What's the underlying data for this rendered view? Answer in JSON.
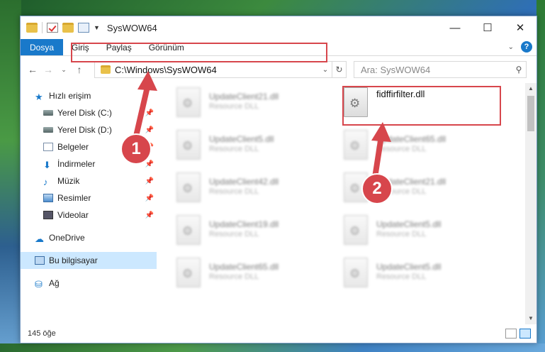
{
  "window": {
    "title": "SysWOW64",
    "controls": {
      "minimize": "—",
      "maximize": "☐",
      "close": "✕"
    }
  },
  "ribbon": {
    "tabs": [
      "Dosya",
      "Giriş",
      "Paylaş",
      "Görünüm"
    ],
    "help": "?"
  },
  "navbar": {
    "address": "C:\\Windows\\SysWOW64",
    "search_placeholder": "Ara: SysWOW64"
  },
  "sidebar": {
    "quick_access": "Hızlı erişim",
    "items": [
      {
        "label": "Yerel Disk (C:)"
      },
      {
        "label": "Yerel Disk (D:)"
      },
      {
        "label": "Belgeler"
      },
      {
        "label": "İndirmeler"
      },
      {
        "label": "Müzik"
      },
      {
        "label": "Resimler"
      },
      {
        "label": "Videolar"
      }
    ],
    "onedrive": "OneDrive",
    "this_pc": "Bu bilgisayar",
    "network": "Ağ"
  },
  "files": {
    "target": {
      "name": "fidffirfilter.dll"
    },
    "blurred": [
      {
        "name": "UpdateClient21.dll",
        "type": "Resource DLL"
      },
      {
        "name": "UpdateClient5.dll",
        "type": "Resource DLL"
      },
      {
        "name": "UpdateClient65.dll",
        "type": "Resource DLL"
      },
      {
        "name": "UpdateClient42.dll",
        "type": "Resource DLL"
      },
      {
        "name": "UpdateClient21.dll",
        "type": "Resource DLL"
      },
      {
        "name": "UpdateClient19.dll",
        "type": "Resource DLL"
      },
      {
        "name": "UpdateClient5.dll",
        "type": "Resource DLL"
      },
      {
        "name": "UpdateClient65.dll",
        "type": "Resource DLL"
      },
      {
        "name": "UpdateClient5.dll",
        "type": "Resource DLL"
      }
    ]
  },
  "status": {
    "count": "145 öğe"
  },
  "callouts": {
    "one": "1",
    "two": "2"
  },
  "colors": {
    "accent": "#1979ca",
    "highlight": "#d7464c"
  }
}
